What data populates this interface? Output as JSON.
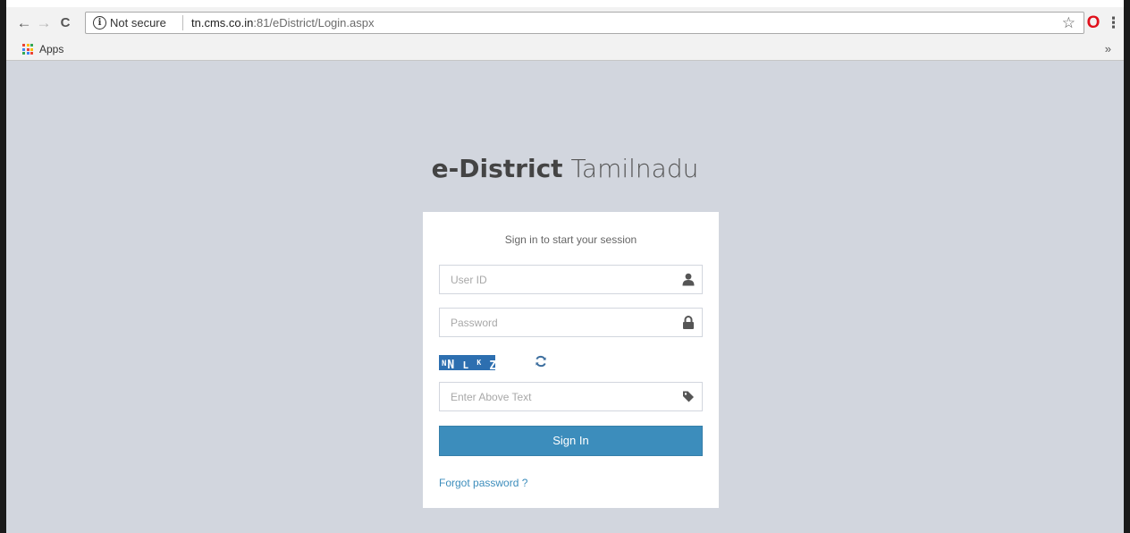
{
  "browser": {
    "nav": {
      "back": "←",
      "forward": "→",
      "reload": "C"
    },
    "omnibox": {
      "info_glyph": "i",
      "security_label": "Not secure",
      "url_host": "tn.cms.co.in",
      "url_rest": ":81/eDistrict/Login.aspx"
    },
    "menu_glyph": "⋮",
    "extension_glyph": "O",
    "star_glyph": "☆",
    "bookmarks": {
      "apps_label": "Apps",
      "overflow": "»"
    }
  },
  "page": {
    "brand_bold": "e-District",
    "brand_light": "Tamilnadu",
    "login_message": "Sign in to start your session",
    "userid": {
      "placeholder": "User ID",
      "icon": "user-icon"
    },
    "password": {
      "placeholder": "Password",
      "icon": "lock-icon"
    },
    "captcha": {
      "chars": [
        "N",
        "N",
        "L",
        "K",
        "Z"
      ],
      "icon": "refresh-icon"
    },
    "captcha_input": {
      "placeholder": "Enter Above Text",
      "icon": "tag-icon"
    },
    "signin_label": "Sign In",
    "forgot_label": "Forgot password ?"
  },
  "colors": {
    "page_background": "#d2d6de",
    "primary_button": "#3c8dbc",
    "link": "#3c8dbc",
    "captcha_background": "#2d6fb0"
  }
}
